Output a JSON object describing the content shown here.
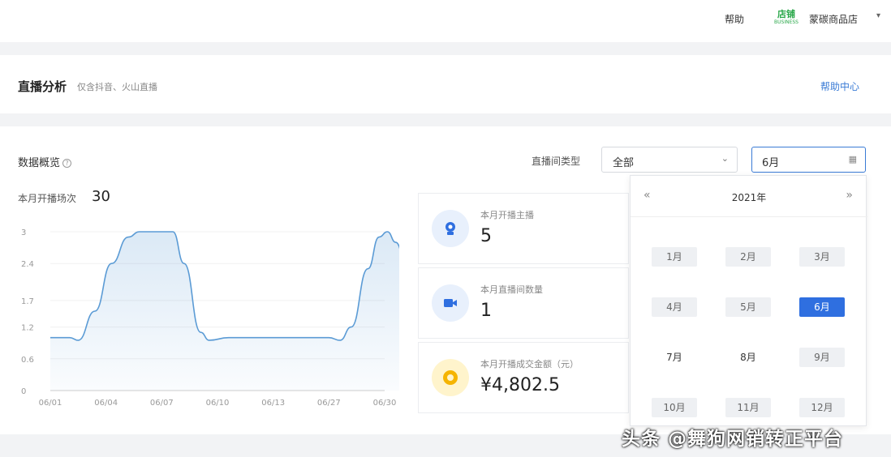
{
  "topbar": {
    "help": "帮助",
    "logo_text": "店铺",
    "logo_sub": "BUSINESS",
    "shop_name": "蒙碳商品店",
    "caret": "▾"
  },
  "header": {
    "title": "直播分析",
    "subtitle": "仅含抖音、火山直播",
    "help_center": "帮助中心"
  },
  "overview": {
    "label": "数据概览",
    "monthly_count_label": "本月开播场次",
    "monthly_count_value": "30"
  },
  "filters": {
    "type_label": "直播间类型",
    "type_value": "全部",
    "month_value": "6月"
  },
  "stats": [
    {
      "label": "本月开播主播",
      "value": "5",
      "icon": "anchor-icon",
      "color": "#2f6fe0"
    },
    {
      "label": "本月直播间数量",
      "value": "1",
      "icon": "video-camera-icon",
      "color": "#2f6fe0"
    },
    {
      "label": "本月开播成交金额（元）",
      "value": "¥4,802.5",
      "icon": "coin-icon",
      "color": "#f5b400"
    }
  ],
  "picker": {
    "prev": "«",
    "next": "»",
    "year": "2021年",
    "months": [
      "1月",
      "2月",
      "3月",
      "4月",
      "5月",
      "6月",
      "7月",
      "8月",
      "9月",
      "10月",
      "11月",
      "12月"
    ],
    "selected": "6月"
  },
  "chart_data": {
    "type": "area",
    "x_ticks": [
      "06/01",
      "06/04",
      "06/07",
      "06/10",
      "06/13",
      "06/27",
      "06/30"
    ],
    "y_ticks": [
      "0",
      "0.6",
      "1.2",
      "1.7",
      "2.4",
      "3"
    ],
    "ylim": [
      0,
      3
    ],
    "series": [
      {
        "points": [
          [
            0,
            1
          ],
          [
            0.35,
            1
          ],
          [
            0.5,
            0.95
          ],
          [
            0.8,
            1.5
          ],
          [
            1.1,
            2.4
          ],
          [
            1.4,
            2.9
          ],
          [
            1.6,
            3
          ],
          [
            2.2,
            3
          ],
          [
            2.4,
            2.4
          ],
          [
            2.7,
            1.1
          ],
          [
            2.85,
            0.95
          ],
          [
            3.2,
            1
          ],
          [
            4.5,
            1
          ],
          [
            5.0,
            1
          ],
          [
            5.2,
            0.95
          ],
          [
            5.4,
            1.2
          ],
          [
            5.7,
            2.3
          ],
          [
            5.9,
            2.9
          ],
          [
            6.05,
            3
          ],
          [
            6.2,
            2.8
          ],
          [
            6.45,
            2.0
          ]
        ],
        "color": "#5b9bd5"
      }
    ]
  },
  "watermark": "头条 @舞狗网销转正平台"
}
